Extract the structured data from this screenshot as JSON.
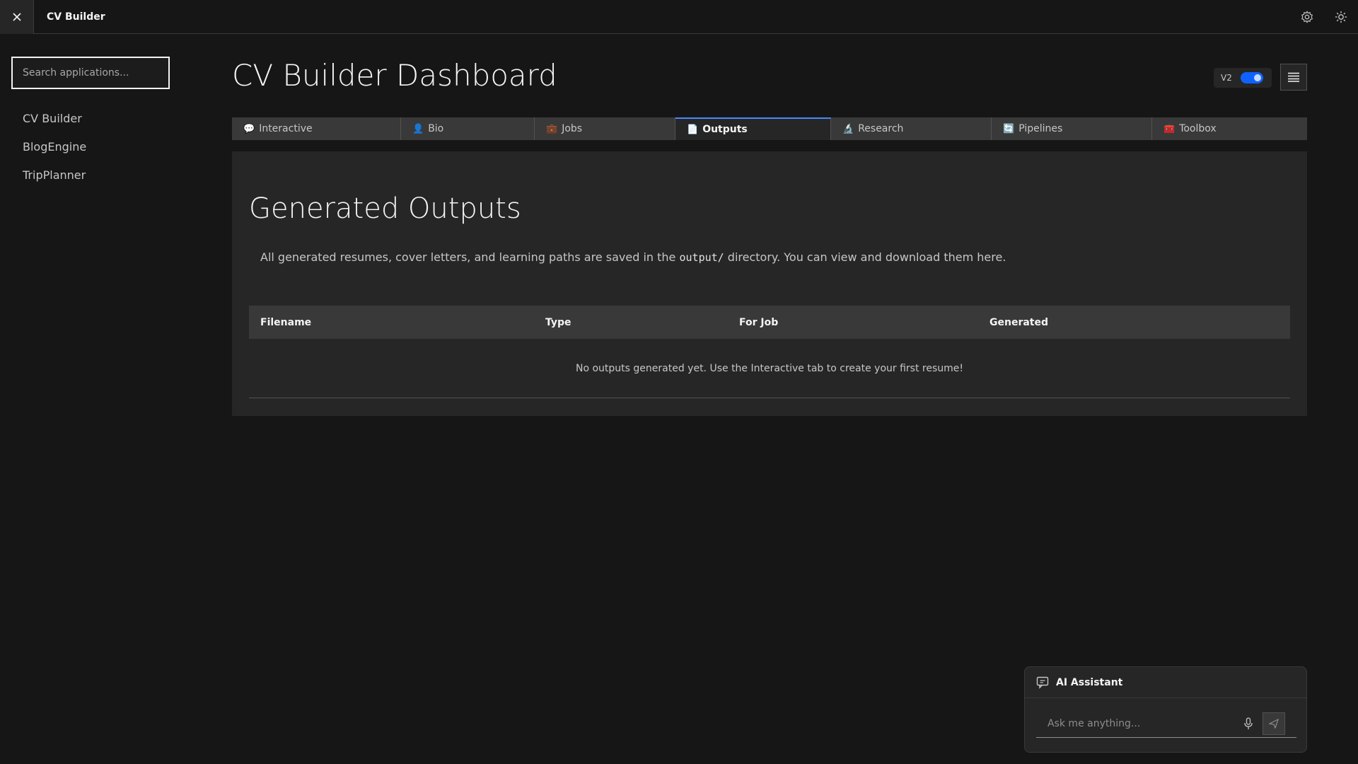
{
  "header": {
    "app_name": "CV Builder"
  },
  "sidebar": {
    "search_placeholder": "Search applications...",
    "items": [
      {
        "label": "CV Builder"
      },
      {
        "label": "BlogEngine"
      },
      {
        "label": "TripPlanner"
      }
    ]
  },
  "main": {
    "title": "CV Builder Dashboard",
    "version_label": "V2",
    "version_enabled": true,
    "tabs": [
      {
        "icon": "💬",
        "label": "Interactive"
      },
      {
        "icon": "👤",
        "label": "Bio"
      },
      {
        "icon": "💼",
        "label": "Jobs"
      },
      {
        "icon": "📄",
        "label": "Outputs",
        "active": true
      },
      {
        "icon": "🔬",
        "label": "Research"
      },
      {
        "icon": "🔄",
        "label": "Pipelines"
      },
      {
        "icon": "🧰",
        "label": "Toolbox"
      }
    ]
  },
  "outputs": {
    "title": "Generated Outputs",
    "desc_before": "All generated resumes, cover letters, and learning paths are saved in the ",
    "desc_code": "output/",
    "desc_after": " directory. You can view and download them here.",
    "columns": [
      "Filename",
      "Type",
      "For Job",
      "Generated"
    ],
    "empty_message": "No outputs generated yet. Use the Interactive tab to create your first resume!"
  },
  "assistant": {
    "title": "AI Assistant",
    "placeholder": "Ask me anything..."
  },
  "colors": {
    "accent": "#4589ff",
    "toggle": "#0f62fe",
    "background": "#161616",
    "panel": "#262626"
  }
}
